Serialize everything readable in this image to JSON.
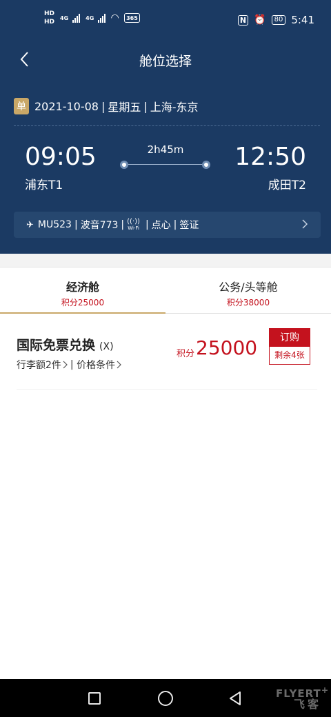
{
  "status_bar": {
    "hd1": "HD",
    "hd2": "HD",
    "net1": "4G",
    "net2": "4G",
    "calendar_badge": "365",
    "nfc": "N",
    "battery": "80",
    "time": "5:41"
  },
  "nav": {
    "title": "舱位选择"
  },
  "flight": {
    "trip_badge": "单",
    "date": "2021-10-08",
    "weekday": "星期五",
    "route": "上海-东京",
    "departure_time": "09:05",
    "departure_terminal": "浦东T1",
    "arrival_time": "12:50",
    "arrival_terminal": "成田T2",
    "duration": "2h45m",
    "flight_no": "MU523",
    "aircraft": "波音773",
    "wifi_badge": "Wi-Fi",
    "meal": "点心",
    "visa": "签证"
  },
  "tabs": [
    {
      "label": "经济舱",
      "points": "积分25000"
    },
    {
      "label": "公务/头等舱",
      "points": "积分38000"
    }
  ],
  "fare": {
    "title": "国际免票兑换",
    "class_code": "(X)",
    "baggage": "行李额2件",
    "conditions": "价格条件",
    "points_label": "积分",
    "points_value": "25000",
    "book_label": "订购",
    "remaining": "剩余4张"
  },
  "watermark": {
    "line1": "FLYERT",
    "line2": "飞客"
  },
  "colors": {
    "header": "#1b3a63",
    "accent_red": "#c4121e",
    "gold": "#c9a767"
  }
}
